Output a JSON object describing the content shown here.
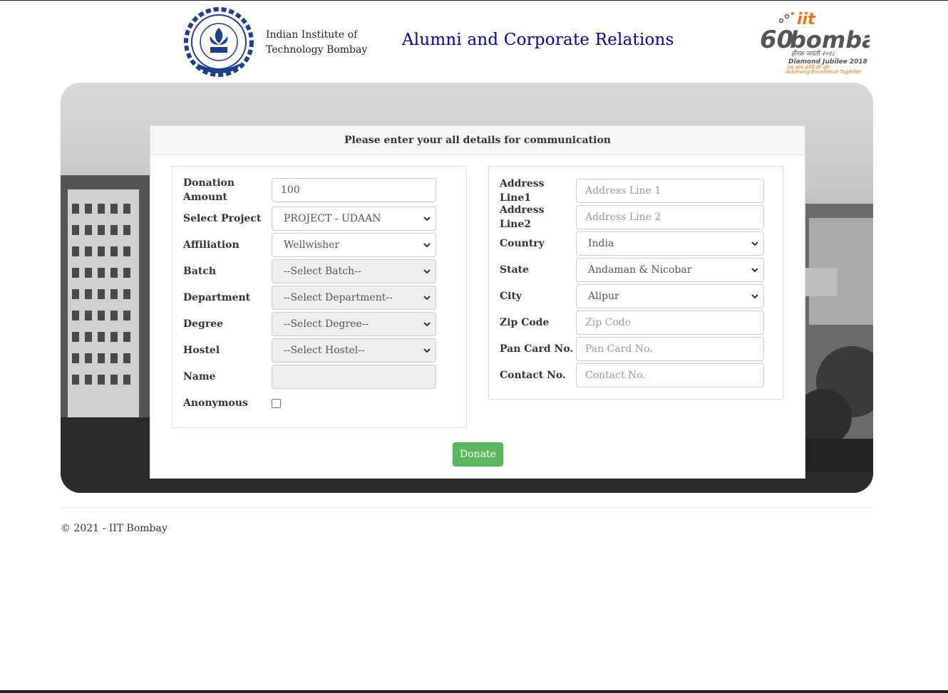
{
  "header": {
    "institute_name_line1": "Indian Institute of",
    "institute_name_line2": "Technology Bombay",
    "site_title": "Alumni and Corporate Relations",
    "jubilee_logo_text_top": "iit",
    "jubilee_logo_text_main": "bombay",
    "jubilee_logo_text_number": "60",
    "jubilee_logo_hindi": "हीरक जयंती २०१८",
    "jubilee_logo_english": "Diamond Jubilee 2018",
    "jubilee_logo_hindi2": "एक साथ क्रांति की ओर",
    "jubilee_logo_tagline": "Achieving Excellence Together"
  },
  "form": {
    "heading": "Please enter your all details for communication",
    "left": {
      "donation_amount_label": "Donation Amount",
      "donation_amount_value": "100",
      "select_project_label": "Select Project",
      "select_project_value": "PROJECT - UDAAN",
      "affiliation_label": "Affiliation",
      "affiliation_value": "Wellwisher",
      "batch_label": "Batch",
      "batch_value": "--Select Batch--",
      "department_label": "Department",
      "department_value": "--Select Department--",
      "degree_label": "Degree",
      "degree_value": "--Select Degree--",
      "hostel_label": "Hostel",
      "hostel_value": "--Select Hostel--",
      "name_label": "Name",
      "name_value": "",
      "anonymous_label": "Anonymous"
    },
    "right": {
      "address1_label": "Address Line1",
      "address1_placeholder": "Address Line 1",
      "address2_label": "Address Line2",
      "address2_placeholder": "Address Line 2",
      "country_label": "Country",
      "country_value": "India",
      "state_label": "State",
      "state_value": "Andaman & Nicobar",
      "city_label": "City",
      "city_value": "Alipur",
      "zip_label": "Zip Code",
      "zip_placeholder": "Zip Code",
      "pan_label": "Pan Card No.",
      "pan_placeholder": "Pan Card No.",
      "contact_label": "Contact No.",
      "contact_placeholder": "Contact No."
    },
    "donate_button": "Donate"
  },
  "footer": {
    "copyright": "© 2021 - IIT Bombay"
  },
  "colors": {
    "title_blue": "#00008b",
    "button_green": "#5cb85c",
    "jubilee_orange": "#e8731c",
    "jubilee_grey": "#555555"
  }
}
